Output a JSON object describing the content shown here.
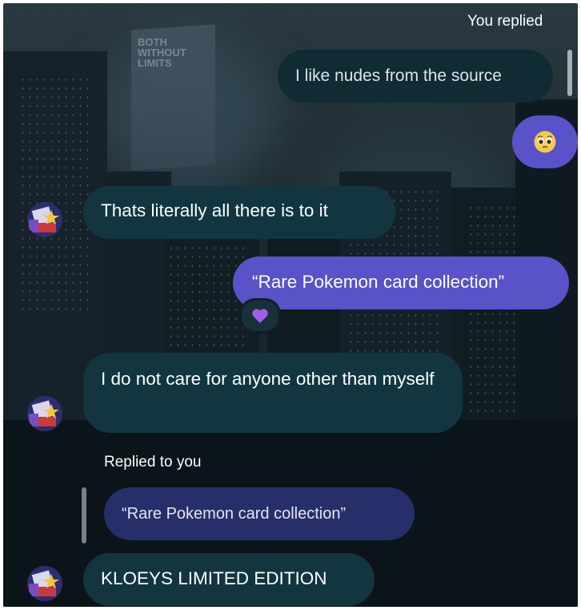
{
  "thread": {
    "you_replied_label": "You replied",
    "replied_to_you_label": "Replied to you",
    "messages": [
      {
        "sender": "me",
        "text": "I like nudes from the source"
      },
      {
        "sender": "me",
        "emoji": "pleading-face"
      },
      {
        "sender": "them",
        "text": "Thats literally all there is to it"
      },
      {
        "sender": "me",
        "text": "“Rare Pokemon card collection”",
        "reaction": "purple-heart"
      },
      {
        "sender": "them",
        "text": "I do not care for anyone other than myself"
      },
      {
        "sender": "them",
        "quoted_text": "“Rare Pokemon card collection”",
        "text": "KLOEYS LIMITED EDITION"
      }
    ]
  },
  "colors": {
    "sent_bubble": "#5a52c8",
    "received_bubble": "#123540",
    "quoted_bubble": "#272f6b"
  }
}
